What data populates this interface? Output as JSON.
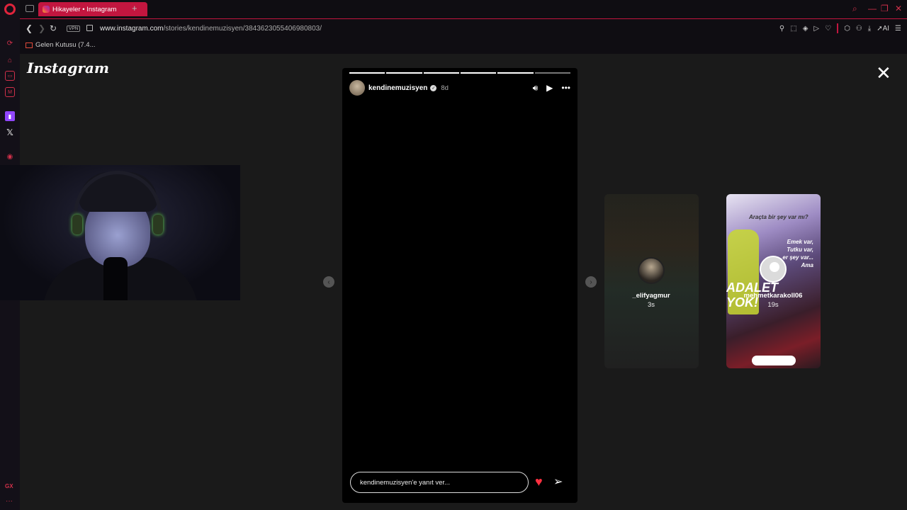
{
  "browser": {
    "tab_title": "Hikayeler • Instagram",
    "new_tab": "+",
    "url_host": "www.instagram.com",
    "url_path": "/stories/kendinemuzisyen/3843623055406980803/",
    "vpn_label": "VPN",
    "bookmark_label": "Gelen Kutusu (7.4...",
    "toolbar_ai": "AI"
  },
  "page": {
    "logo_text": "Instagram"
  },
  "story": {
    "username": "kendinemuzisyen",
    "time_ago": "8d",
    "reply_placeholder": "kendinemuzisyen'e yanıt ver...",
    "progress_total": 6,
    "progress_completed": 5
  },
  "upcoming": [
    {
      "username": "_elifyagmur",
      "time_ago": "3s"
    },
    {
      "username": "mehmetkarakoll06",
      "time_ago": "19s"
    }
  ],
  "preview2_text": {
    "top": "Araçta bir şey var mı?",
    "lines": "Emek var,\nTutku var,\n…er şey var...\nAma",
    "big": "ADALET YOK!"
  },
  "colors": {
    "accent": "#c2163f",
    "like": "#ff3040",
    "page_bg": "#1a1a1a"
  }
}
